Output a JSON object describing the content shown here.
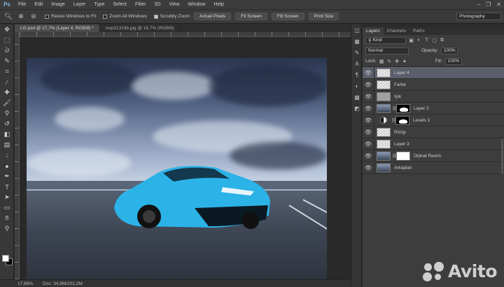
{
  "app": {
    "logo": "Ps"
  },
  "menu": [
    "File",
    "Edit",
    "Image",
    "Layer",
    "Type",
    "Select",
    "Filter",
    "3D",
    "View",
    "Window",
    "Help"
  ],
  "window_controls": [
    "–",
    "❐",
    "✕"
  ],
  "options": {
    "resize_windows": "Resize Windows to Fit",
    "zoom_all": "Zoom All Windows",
    "scrubby_zoom": "Scrubby Zoom",
    "actual_pixels": "Actual Pixels",
    "fit_screen": "Fit Screen",
    "fill_screen": "Fill Screen",
    "print_size": "Print Size",
    "workspace": "Photography"
  },
  "tabs": [
    {
      "label": "LG.psd @ 17,7% (Layer 4, RGB/8) *",
      "active": true
    },
    {
      "label": "lxxp31319b.jpg @ 16,7% (RGB/8)",
      "active": false
    }
  ],
  "status": {
    "zoom": "17,68%",
    "doc": "Doc: 34,9M/202,2M"
  },
  "layers_panel": {
    "tabs": [
      "Layers",
      "Channels",
      "Paths"
    ],
    "filter_kind": "Kind",
    "blend_mode": "Normal",
    "opacity_label": "Opacity:",
    "opacity_value": "100%",
    "lock_label": "Lock:",
    "fill_label": "Fill:",
    "fill_value": "100%",
    "layers": [
      {
        "name": "Layer 4",
        "thumb": "transparent",
        "mask": "",
        "selected": true
      },
      {
        "name": "Farlar",
        "thumb": "transparent",
        "mask": "",
        "selected": false
      },
      {
        "name": "Işık",
        "thumb": "gray",
        "mask": "",
        "selected": false
      },
      {
        "name": "Layer 2",
        "thumb": "dark",
        "mask": "black",
        "selected": false
      },
      {
        "name": "Levels 1",
        "thumb": "adj",
        "mask": "black",
        "selected": false
      },
      {
        "name": "Rüzgı",
        "thumb": "transparent",
        "mask": "",
        "selected": false
      },
      {
        "name": "Layer 3",
        "thumb": "transparent",
        "mask": "",
        "selected": false
      },
      {
        "name": "Orjinal Resim",
        "thumb": "dark",
        "mask": "white",
        "selected": false
      },
      {
        "name": "Arkaplan",
        "thumb": "dark",
        "mask": "",
        "selected": false
      }
    ]
  },
  "watermark": {
    "text": "Avito"
  }
}
